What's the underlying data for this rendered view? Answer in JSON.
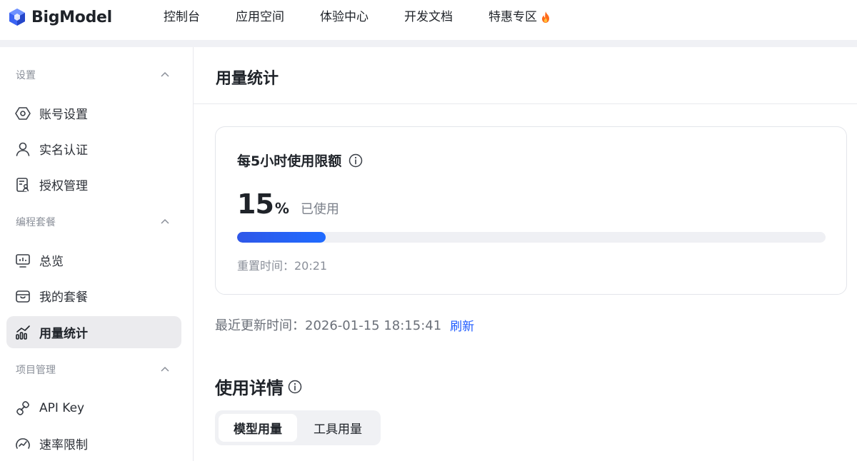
{
  "brand": {
    "name": "BigModel"
  },
  "nav": {
    "items": [
      {
        "label": "控制台"
      },
      {
        "label": "应用空间"
      },
      {
        "label": "体验中心"
      },
      {
        "label": "开发文档"
      },
      {
        "label": "特惠专区",
        "icon": "fire-icon"
      }
    ]
  },
  "sidebar": {
    "sections": [
      {
        "title": "设置",
        "items": [
          {
            "label": "账号设置",
            "icon": "hexagon-settings-icon"
          },
          {
            "label": "实名认证",
            "icon": "user-icon"
          },
          {
            "label": "授权管理",
            "icon": "document-person-icon"
          }
        ]
      },
      {
        "title": "编程套餐",
        "items": [
          {
            "label": "总览",
            "icon": "monitor-chart-icon"
          },
          {
            "label": "我的套餐",
            "icon": "package-box-icon"
          },
          {
            "label": "用量统计",
            "icon": "bar-trend-icon",
            "active": true
          }
        ]
      },
      {
        "title": "项目管理",
        "items": [
          {
            "label": "API Key",
            "icon": "key-link-icon"
          },
          {
            "label": "速率限制",
            "icon": "speedometer-icon"
          }
        ]
      }
    ]
  },
  "main": {
    "title": "用量统计",
    "quota_card": {
      "title": "每5小时使用限额",
      "percent_value": "15",
      "percent_unit": "%",
      "used_label": "已使用",
      "progress_fraction": 0.15,
      "reset_text": "重置时间：20:21"
    },
    "updated_text": "最近更新时间：2026-01-15 18:15:41",
    "refresh_label": "刷新",
    "detail": {
      "title": "使用详情",
      "tabs": [
        {
          "label": "模型用量",
          "active": true
        },
        {
          "label": "工具用量",
          "active": false
        }
      ]
    }
  },
  "colors": {
    "accent": "#1f5bff",
    "progress_fill": "#2f57e8",
    "sidebar_active_bg": "#ebebee"
  }
}
